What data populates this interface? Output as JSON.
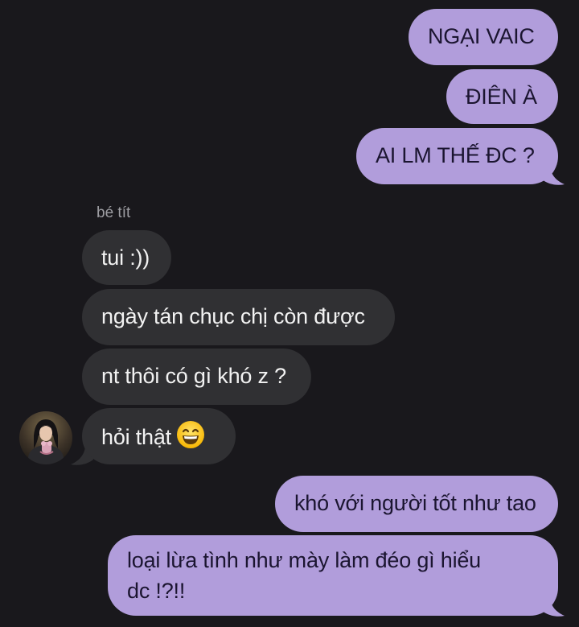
{
  "conversation": {
    "sender_name": "bé tít",
    "messages": [
      {
        "text": "NGẠI VAIC",
        "direction": "outgoing"
      },
      {
        "text": "ĐIÊN À",
        "direction": "outgoing"
      },
      {
        "text": "AI LM THẾ ĐC ?",
        "direction": "outgoing"
      },
      {
        "text": "tui :))",
        "direction": "incoming"
      },
      {
        "text": "ngày tán chục chị còn được",
        "direction": "incoming"
      },
      {
        "text": "nt thôi có gì khó z ?",
        "direction": "incoming"
      },
      {
        "text": "hỏi thật",
        "direction": "incoming",
        "emoji": "grinning-face-emoji"
      },
      {
        "text": "khó với người tốt như tao",
        "direction": "outgoing"
      },
      {
        "text": "loại lừa tình như mày làm đéo gì hiểu",
        "direction": "outgoing"
      },
      {
        "text": "dc !?!!",
        "direction": "outgoing"
      }
    ]
  },
  "colors": {
    "background": "#19181c",
    "outgoing_bubble": "#b19ddb",
    "incoming_bubble": "#303033",
    "sender_name": "#9e9ea3"
  }
}
